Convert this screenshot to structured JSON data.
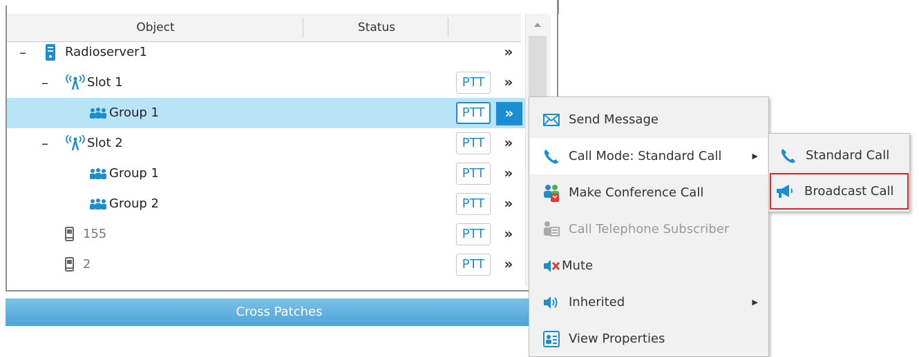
{
  "header": {
    "col_object": "Object",
    "col_status": "Status"
  },
  "tree": [
    {
      "label": "Radioserver1",
      "expander": "–",
      "icon": "server-icon",
      "ptt": "",
      "arrow": "»"
    },
    {
      "label": "Slot 1",
      "expander": "–",
      "icon": "antenna-icon",
      "ptt": "PTT",
      "arrow": "»"
    },
    {
      "label": "Group 1",
      "expander": "",
      "icon": "group-icon",
      "ptt": "PTT",
      "arrow": "»",
      "selected": true
    },
    {
      "label": "Slot 2",
      "expander": "–",
      "icon": "antenna-icon",
      "ptt": "PTT",
      "arrow": "»"
    },
    {
      "label": "Group 1",
      "expander": "",
      "icon": "group-icon",
      "ptt": "PTT",
      "arrow": "»"
    },
    {
      "label": "Group 2",
      "expander": "",
      "icon": "group-icon",
      "ptt": "PTT",
      "arrow": "»"
    },
    {
      "label": "155",
      "expander": "",
      "icon": "handset-icon",
      "ptt": "PTT",
      "arrow": "»"
    },
    {
      "label": "2",
      "expander": "",
      "icon": "handset-icon",
      "ptt": "PTT",
      "arrow": "»"
    }
  ],
  "cross_patches": "Cross Patches",
  "context_menu": {
    "send_message": "Send Message",
    "call_mode": "Call Mode: Standard Call",
    "make_conference": "Make Conference Call",
    "call_telephone": "Call Telephone Subscriber",
    "mute": "Mute",
    "inherited": "Inherited",
    "view_properties": "View Properties"
  },
  "submenu": {
    "standard_call": "Standard Call",
    "broadcast_call": "Broadcast Call"
  },
  "colors": {
    "accent": "#1b8ed1",
    "selection": "#b9e4f7",
    "highlight_box": "#e0242b"
  }
}
